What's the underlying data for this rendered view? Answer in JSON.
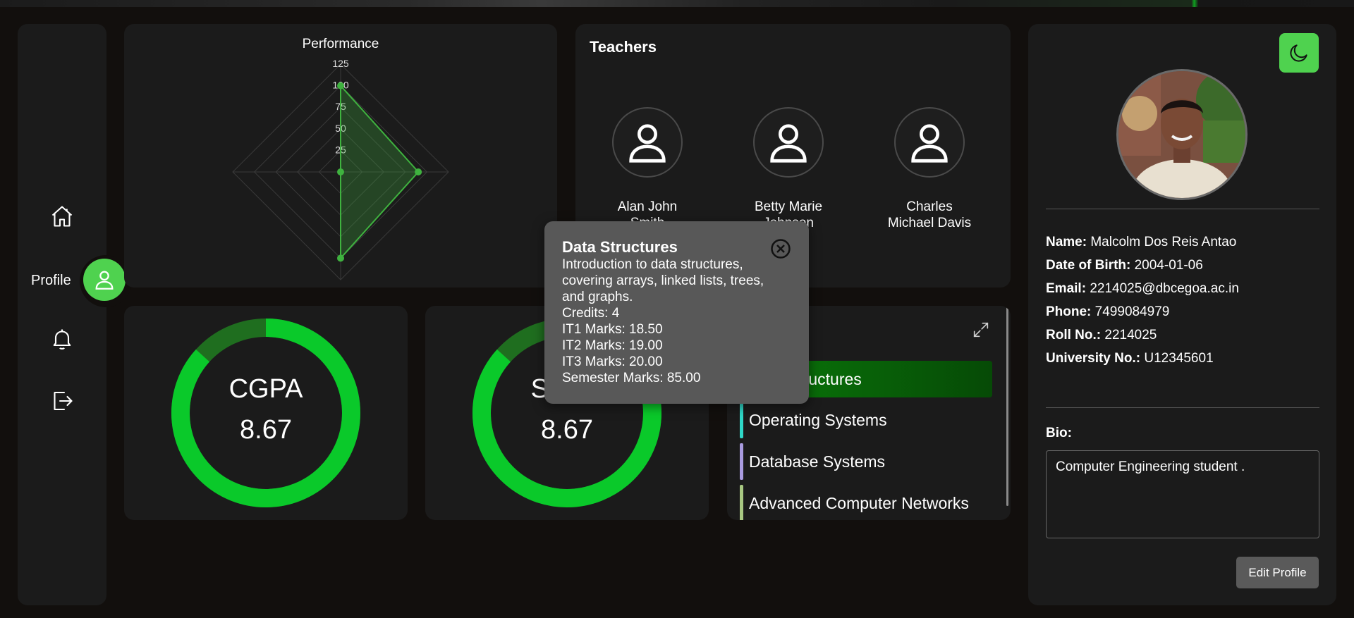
{
  "sidebar": {
    "profile_label": "Profile",
    "items": [
      {
        "icon": "home-icon"
      },
      {
        "icon": "user-icon"
      },
      {
        "icon": "bell-icon"
      },
      {
        "icon": "logout-icon"
      }
    ]
  },
  "performance": {
    "title": "Performance"
  },
  "chart_data": {
    "type": "radar",
    "title": "Performance",
    "axes_count": 4,
    "tick_labels": [
      "25",
      "50",
      "75",
      "100",
      "125"
    ],
    "rlim": [
      0,
      125
    ],
    "series": [
      {
        "color": "#3fb23f",
        "values": [
          100,
          90,
          100,
          0
        ]
      }
    ],
    "grid": true
  },
  "teachers": {
    "title": "Teachers",
    "list": [
      {
        "name_line1": "Alan John",
        "name_line2": "Smith"
      },
      {
        "name_line1": "Betty Marie",
        "name_line2": "Johnson"
      },
      {
        "name_line1": "Charles",
        "name_line2": "Michael Davis"
      }
    ]
  },
  "gauges": [
    {
      "label": "CGPA",
      "value": "8.67",
      "fraction": 0.867
    },
    {
      "label": "SGPA",
      "value": "8.67",
      "fraction": 0.867
    }
  ],
  "subjects": {
    "items": [
      {
        "name": "Data Structures",
        "color": "#0a7a0a",
        "active": true
      },
      {
        "name": "Operating Systems",
        "color": "#2fd8c8"
      },
      {
        "name": "Database Systems",
        "color": "#a99be0"
      },
      {
        "name": "Advanced Computer Networks",
        "color": "#a8c882"
      }
    ]
  },
  "popup": {
    "title": "Data Structures",
    "desc1": "Introduction to data structures,",
    "desc2": "covering arrays, linked lists, trees,",
    "desc3": "and graphs.",
    "credits": "Credits: 4",
    "it1": "IT1 Marks: 18.50",
    "it2": "IT2 Marks: 19.00",
    "it3": "IT3 Marks: 20.00",
    "sem": "Semester Marks: 85.00"
  },
  "profile": {
    "name_label": "Name:",
    "name": "Malcolm Dos Reis Antao",
    "dob_label": "Date of Birth:",
    "dob": "2004-01-06",
    "email_label": "Email:",
    "email": "2214025@dbcegoa.ac.in",
    "phone_label": "Phone:",
    "phone": "7499084979",
    "roll_label": "Roll No.:",
    "roll": "2214025",
    "univ_label": "University No.:",
    "univ": "U12345601",
    "bio_label": "Bio:",
    "bio": "Computer Engineering student .",
    "edit_label": "Edit Profile"
  },
  "colors": {
    "accent": "#4fd24f",
    "gauge_fill": "#0ac92a",
    "gauge_track": "#1f6e1f",
    "background": "#120f0d",
    "card": "#1b1b1b"
  }
}
